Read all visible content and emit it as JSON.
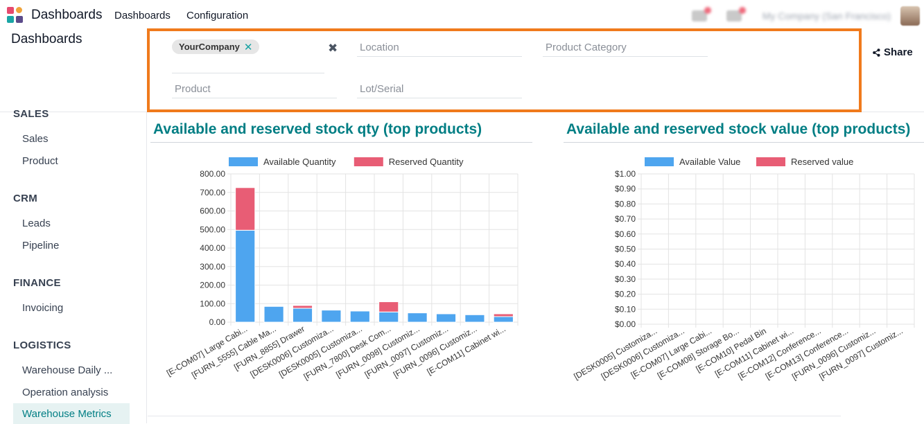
{
  "navbar": {
    "app_title": "Dashboards",
    "menu_items": [
      "Dashboards",
      "Configuration"
    ],
    "company": "My Company (San Francisco)"
  },
  "control_panel": {
    "breadcrumb": "Dashboards",
    "facet_chip": "YourCompany",
    "fields": {
      "location": "Location",
      "product_category": "Product Category",
      "product": "Product",
      "lot_serial": "Lot/Serial"
    },
    "share_label": "Share"
  },
  "sidebar": {
    "sections": [
      {
        "title": "SALES",
        "items": [
          "Sales",
          "Product"
        ]
      },
      {
        "title": "CRM",
        "items": [
          "Leads",
          "Pipeline"
        ]
      },
      {
        "title": "FINANCE",
        "items": [
          "Invoicing"
        ]
      },
      {
        "title": "LOGISTICS",
        "items": [
          "Warehouse Daily ...",
          "Operation analysis",
          "Warehouse Metrics"
        ]
      }
    ],
    "active_item": "Warehouse Metrics"
  },
  "colors": {
    "accent": "#017e84",
    "available": "#4ea5ef",
    "reserved": "#e85d75",
    "highlight_border": "#f07a1c"
  },
  "chart_data": [
    {
      "type": "bar",
      "stacked": true,
      "title": "Available and reserved stock qty (top products)",
      "legend_position": "top",
      "categories": [
        "[E-COM07] Large Cabi...",
        "[FURN_5555] Cable Ma...",
        "[FURN_8855] Drawer",
        "[DESK0006] Customiza...",
        "[DESK0005] Customiza...",
        "[FURN_7800] Desk Com...",
        "[FURN_0098] Customiz...",
        "[FURN_0097] Customiz...",
        "[FURN_0096] Customiz...",
        "[E-COM11] Cabinet wi..."
      ],
      "series": [
        {
          "name": "Available Quantity",
          "values": [
            496,
            85,
            75,
            65,
            60,
            55,
            50,
            45,
            40,
            30
          ]
        },
        {
          "name": "Reserved Quantity",
          "values": [
            230,
            0,
            15,
            0,
            0,
            55,
            0,
            0,
            0,
            15
          ]
        }
      ],
      "ylim": [
        0,
        800
      ],
      "yticks": [
        "800.00",
        "700.00",
        "600.00",
        "500.00",
        "400.00",
        "300.00",
        "200.00",
        "100.00",
        "0.00"
      ],
      "grid": true
    },
    {
      "type": "bar",
      "stacked": true,
      "title": "Available and reserved stock value (top products)",
      "legend_position": "top",
      "categories": [
        "[DESK0005] Customiza...",
        "[DESK0006] Customiza...",
        "[E-COM07] Large Cabi...",
        "[E-COM08] Storage Bo...",
        "[E-COM10] Pedal Bin",
        "[E-COM11] Cabinet wi...",
        "[E-COM12] Conference...",
        "[E-COM13] Conference...",
        "[FURN_0096] Customiz...",
        "[FURN_0097] Customiz..."
      ],
      "series": [
        {
          "name": "Available Value",
          "values": [
            0,
            0,
            0,
            0,
            0,
            0,
            0,
            0,
            0,
            0
          ]
        },
        {
          "name": "Reserved value",
          "values": [
            0,
            0,
            0,
            0,
            0,
            0,
            0,
            0,
            0,
            0
          ]
        }
      ],
      "ylim": [
        0,
        1
      ],
      "yticks": [
        "$1.00",
        "$0.90",
        "$0.80",
        "$0.70",
        "$0.60",
        "$0.50",
        "$0.40",
        "$0.30",
        "$0.20",
        "$0.10",
        "$0.00"
      ],
      "grid": true
    }
  ]
}
